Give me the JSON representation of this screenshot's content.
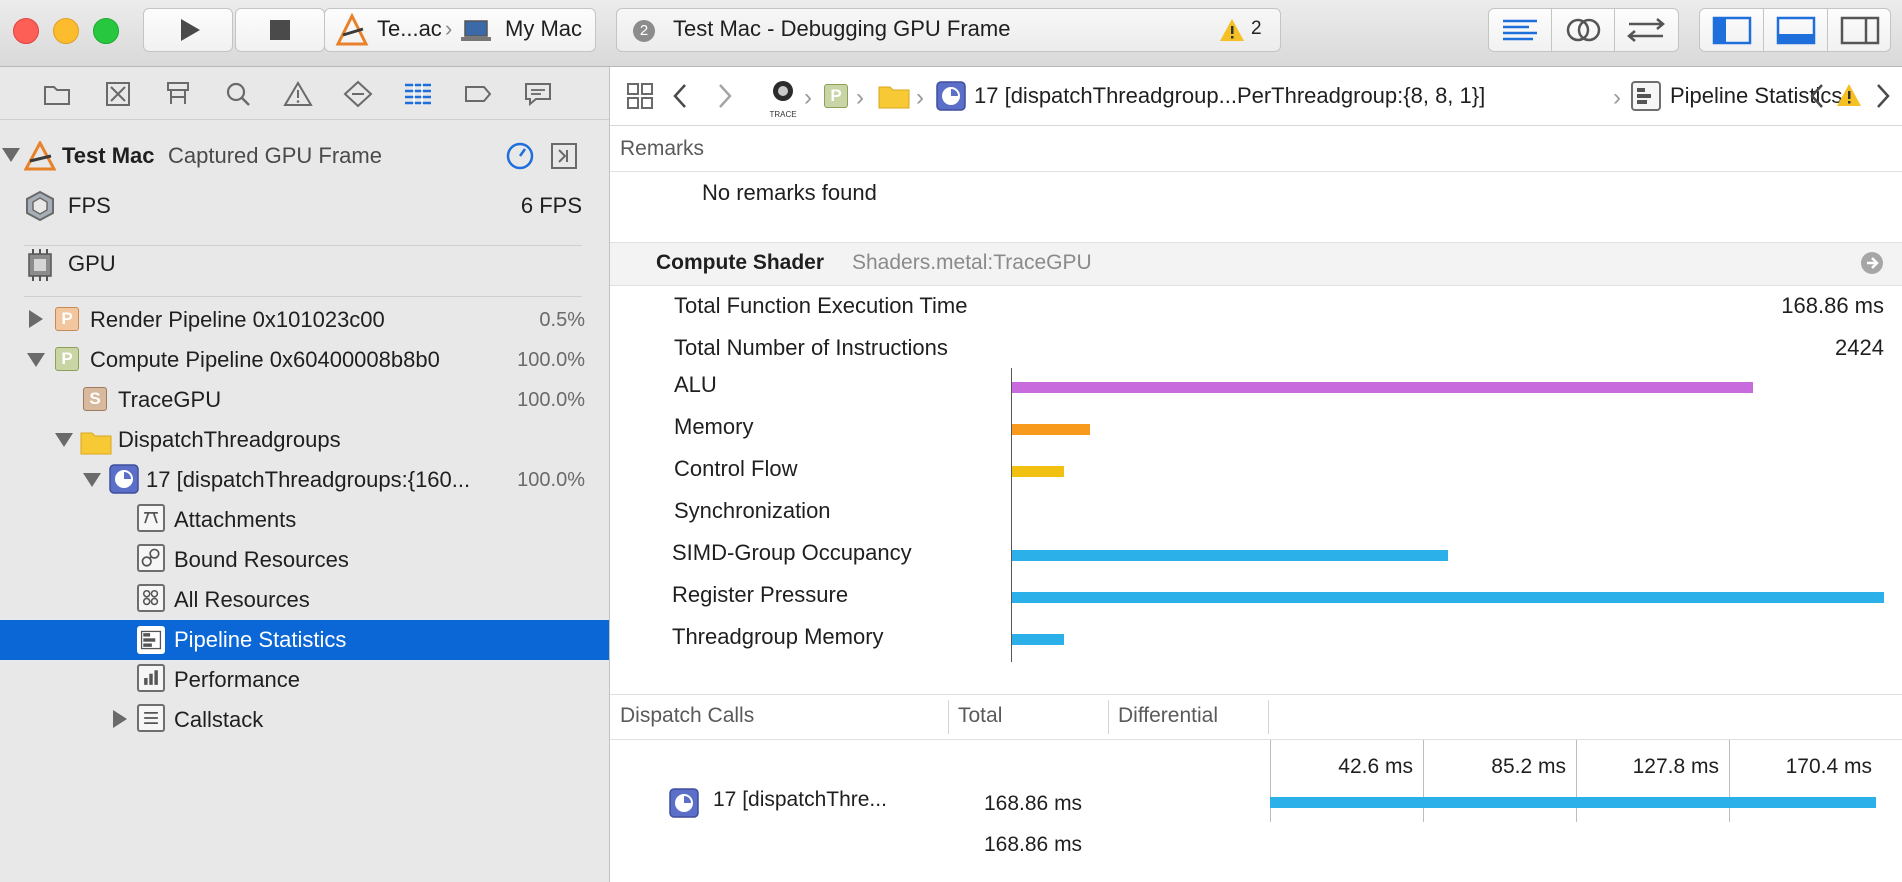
{
  "toolbar": {
    "scheme_target": "Te...ac",
    "scheme_device": "My Mac",
    "activity_badge": "2",
    "activity_text": "Test Mac - Debugging GPU Frame",
    "warning_count": "2"
  },
  "sidebar": {
    "root_title": "Test Mac",
    "root_subtitle": "Captured GPU Frame",
    "fps_label": "FPS",
    "fps_value": "6 FPS",
    "gpu_label": "GPU",
    "items": [
      {
        "label": "Render Pipeline 0x101023c00",
        "percent": "0.5%",
        "badge": "P"
      },
      {
        "label": "Compute Pipeline 0x60400008b8b0",
        "percent": "100.0%",
        "badge": "P"
      },
      {
        "label": "TraceGPU",
        "percent": "100.0%",
        "badge": "S"
      },
      {
        "label": "DispatchThreadgroups",
        "percent": ""
      },
      {
        "label": "17 [dispatchThreadgroups:{160...",
        "percent": "100.0%"
      },
      {
        "label": "Attachments"
      },
      {
        "label": "Bound Resources"
      },
      {
        "label": "All Resources"
      },
      {
        "label": "Pipeline Statistics",
        "selected": true
      },
      {
        "label": "Performance"
      },
      {
        "label": "Callstack"
      }
    ]
  },
  "jumpbar": {
    "trace_label": "TRACE",
    "badge": "P",
    "dispatch_label": "17 [dispatchThreadgroup...PerThreadgroup:{8, 8, 1}]",
    "current": "Pipeline Statistics"
  },
  "remarks": {
    "header": "Remarks",
    "message": "No remarks found"
  },
  "shader": {
    "title": "Compute Shader",
    "source": "Shaders.metal:TraceGPU"
  },
  "metrics": {
    "total_time_label": "Total Function Execution Time",
    "total_time_value": "168.86 ms",
    "total_instr_label": "Total Number of Instructions",
    "total_instr_value": "2424"
  },
  "chart_data": {
    "type": "bar",
    "orientation": "horizontal",
    "categories": [
      "ALU",
      "Memory",
      "Control Flow",
      "Synchronization",
      "SIMD-Group Occupancy",
      "Register Pressure",
      "Threadgroup Memory"
    ],
    "values": [
      85,
      9,
      6,
      0,
      50,
      100,
      6
    ],
    "colors": [
      "#c86bdd",
      "#f89a1c",
      "#f2c011",
      "#2bb0ea",
      "#2bb0ea",
      "#2bb0ea",
      "#2bb0ea"
    ],
    "xlim": [
      0,
      100
    ]
  },
  "dispatch": {
    "headers": [
      "Dispatch Calls",
      "Total",
      "Differential"
    ],
    "row_label": "17 [dispatchThre...",
    "row_total": "168.86 ms",
    "row_total2": "168.86 ms",
    "timeline_ticks": [
      "42.6 ms",
      "85.2 ms",
      "127.8 ms",
      "170.4 ms"
    ],
    "timeline_max_ms": 170.4,
    "bar_value_ms": 168.86
  },
  "colors": {
    "accent": "#0b66d6",
    "selection": "#0b66d6"
  }
}
